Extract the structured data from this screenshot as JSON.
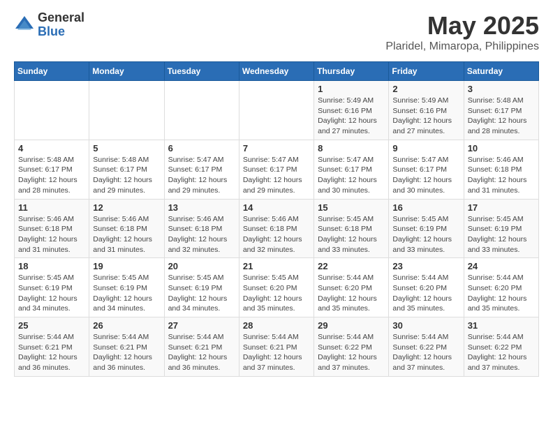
{
  "logo": {
    "general": "General",
    "blue": "Blue"
  },
  "title": "May 2025",
  "subtitle": "Plaridel, Mimaropa, Philippines",
  "weekdays": [
    "Sunday",
    "Monday",
    "Tuesday",
    "Wednesday",
    "Thursday",
    "Friday",
    "Saturday"
  ],
  "weeks": [
    [
      {
        "day": "",
        "info": ""
      },
      {
        "day": "",
        "info": ""
      },
      {
        "day": "",
        "info": ""
      },
      {
        "day": "",
        "info": ""
      },
      {
        "day": "1",
        "info": "Sunrise: 5:49 AM\nSunset: 6:16 PM\nDaylight: 12 hours\nand 27 minutes."
      },
      {
        "day": "2",
        "info": "Sunrise: 5:49 AM\nSunset: 6:16 PM\nDaylight: 12 hours\nand 27 minutes."
      },
      {
        "day": "3",
        "info": "Sunrise: 5:48 AM\nSunset: 6:17 PM\nDaylight: 12 hours\nand 28 minutes."
      }
    ],
    [
      {
        "day": "4",
        "info": "Sunrise: 5:48 AM\nSunset: 6:17 PM\nDaylight: 12 hours\nand 28 minutes."
      },
      {
        "day": "5",
        "info": "Sunrise: 5:48 AM\nSunset: 6:17 PM\nDaylight: 12 hours\nand 29 minutes."
      },
      {
        "day": "6",
        "info": "Sunrise: 5:47 AM\nSunset: 6:17 PM\nDaylight: 12 hours\nand 29 minutes."
      },
      {
        "day": "7",
        "info": "Sunrise: 5:47 AM\nSunset: 6:17 PM\nDaylight: 12 hours\nand 29 minutes."
      },
      {
        "day": "8",
        "info": "Sunrise: 5:47 AM\nSunset: 6:17 PM\nDaylight: 12 hours\nand 30 minutes."
      },
      {
        "day": "9",
        "info": "Sunrise: 5:47 AM\nSunset: 6:17 PM\nDaylight: 12 hours\nand 30 minutes."
      },
      {
        "day": "10",
        "info": "Sunrise: 5:46 AM\nSunset: 6:18 PM\nDaylight: 12 hours\nand 31 minutes."
      }
    ],
    [
      {
        "day": "11",
        "info": "Sunrise: 5:46 AM\nSunset: 6:18 PM\nDaylight: 12 hours\nand 31 minutes."
      },
      {
        "day": "12",
        "info": "Sunrise: 5:46 AM\nSunset: 6:18 PM\nDaylight: 12 hours\nand 31 minutes."
      },
      {
        "day": "13",
        "info": "Sunrise: 5:46 AM\nSunset: 6:18 PM\nDaylight: 12 hours\nand 32 minutes."
      },
      {
        "day": "14",
        "info": "Sunrise: 5:46 AM\nSunset: 6:18 PM\nDaylight: 12 hours\nand 32 minutes."
      },
      {
        "day": "15",
        "info": "Sunrise: 5:45 AM\nSunset: 6:18 PM\nDaylight: 12 hours\nand 33 minutes."
      },
      {
        "day": "16",
        "info": "Sunrise: 5:45 AM\nSunset: 6:19 PM\nDaylight: 12 hours\nand 33 minutes."
      },
      {
        "day": "17",
        "info": "Sunrise: 5:45 AM\nSunset: 6:19 PM\nDaylight: 12 hours\nand 33 minutes."
      }
    ],
    [
      {
        "day": "18",
        "info": "Sunrise: 5:45 AM\nSunset: 6:19 PM\nDaylight: 12 hours\nand 34 minutes."
      },
      {
        "day": "19",
        "info": "Sunrise: 5:45 AM\nSunset: 6:19 PM\nDaylight: 12 hours\nand 34 minutes."
      },
      {
        "day": "20",
        "info": "Sunrise: 5:45 AM\nSunset: 6:19 PM\nDaylight: 12 hours\nand 34 minutes."
      },
      {
        "day": "21",
        "info": "Sunrise: 5:45 AM\nSunset: 6:20 PM\nDaylight: 12 hours\nand 35 minutes."
      },
      {
        "day": "22",
        "info": "Sunrise: 5:44 AM\nSunset: 6:20 PM\nDaylight: 12 hours\nand 35 minutes."
      },
      {
        "day": "23",
        "info": "Sunrise: 5:44 AM\nSunset: 6:20 PM\nDaylight: 12 hours\nand 35 minutes."
      },
      {
        "day": "24",
        "info": "Sunrise: 5:44 AM\nSunset: 6:20 PM\nDaylight: 12 hours\nand 35 minutes."
      }
    ],
    [
      {
        "day": "25",
        "info": "Sunrise: 5:44 AM\nSunset: 6:21 PM\nDaylight: 12 hours\nand 36 minutes."
      },
      {
        "day": "26",
        "info": "Sunrise: 5:44 AM\nSunset: 6:21 PM\nDaylight: 12 hours\nand 36 minutes."
      },
      {
        "day": "27",
        "info": "Sunrise: 5:44 AM\nSunset: 6:21 PM\nDaylight: 12 hours\nand 36 minutes."
      },
      {
        "day": "28",
        "info": "Sunrise: 5:44 AM\nSunset: 6:21 PM\nDaylight: 12 hours\nand 37 minutes."
      },
      {
        "day": "29",
        "info": "Sunrise: 5:44 AM\nSunset: 6:22 PM\nDaylight: 12 hours\nand 37 minutes."
      },
      {
        "day": "30",
        "info": "Sunrise: 5:44 AM\nSunset: 6:22 PM\nDaylight: 12 hours\nand 37 minutes."
      },
      {
        "day": "31",
        "info": "Sunrise: 5:44 AM\nSunset: 6:22 PM\nDaylight: 12 hours\nand 37 minutes."
      }
    ]
  ]
}
